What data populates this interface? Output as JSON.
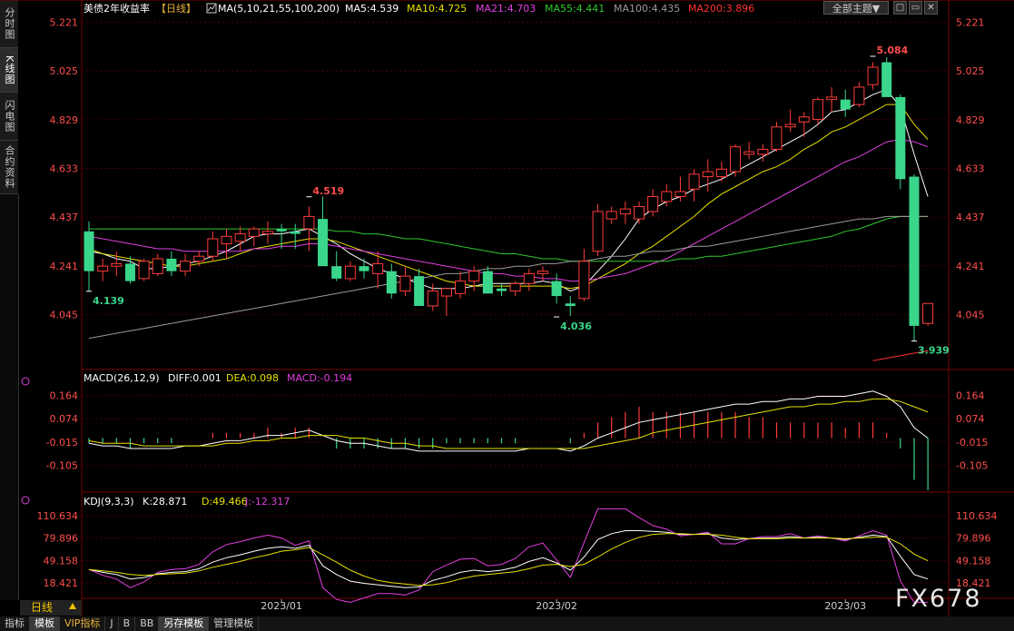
{
  "sidebar": {
    "tabs": [
      "分时图",
      "K线图",
      "闪电图",
      "合约资料"
    ]
  },
  "header": {
    "title": "美债2年收益率",
    "period_tag": "【日线】",
    "ma_label": "MA(5,10,21,55,100,200)",
    "ma5": "MA5:4.539",
    "ma10": "MA10:4.725",
    "ma21": "MA21:4.703",
    "ma55": "MA55:4.441",
    "ma100": "MA100:4.435",
    "ma200": "MA200:3.896",
    "dropdown_label": "全部主题▼",
    "btn_minimize": "□",
    "btn_restore": "▭",
    "btn_close": "✕"
  },
  "macd_header": {
    "label": "MACD(26,12,9)",
    "diff": "DIFF:0.001",
    "dea": "DEA:0.098",
    "macd": "MACD:-0.194"
  },
  "kdj_header": {
    "label": "KDJ(9,3,3)",
    "k": "K:28.871",
    "d": "D:49.466",
    "j": "J:-12.317"
  },
  "period_label": "日线",
  "bottom_tabs": [
    "指标",
    "模板",
    "VIP指标",
    "J",
    "B",
    "BB",
    "另存模板",
    "管理模板"
  ],
  "watermark": "FX678",
  "colors": {
    "up": "#ff3b3b",
    "down": "#3ad68c",
    "ma5": "#ffffff",
    "ma10": "#e6e000",
    "ma21": "#e040e0",
    "ma55": "#2ec82e",
    "ma100": "#9a9a9a",
    "ma200": "#ff3030",
    "axis_text": "#ff4d4d",
    "grid": "#4a0000"
  },
  "chart_data": [
    {
      "type": "candlestick",
      "title": "美债2年收益率",
      "y_ticks": [
        5.221,
        5.025,
        4.829,
        4.633,
        4.437,
        4.241,
        4.045
      ],
      "ylim": [
        3.85,
        5.23
      ],
      "x_ticks": [
        "2023/01",
        "2023/02",
        "2023/03"
      ],
      "annotations": [
        {
          "label": "4.139",
          "index": 0,
          "value": 4.139
        },
        {
          "label": "4.519",
          "index": 16,
          "value": 4.519
        },
        {
          "label": "4.036",
          "index": 34,
          "value": 4.036
        },
        {
          "label": "5.084",
          "index": 57,
          "value": 5.084
        },
        {
          "label": "3.939",
          "index": 60,
          "value": 3.939
        }
      ],
      "ohlc": [
        [
          4.38,
          4.42,
          4.14,
          4.22
        ],
        [
          4.22,
          4.27,
          4.18,
          4.24
        ],
        [
          4.24,
          4.3,
          4.2,
          4.25
        ],
        [
          4.25,
          4.28,
          4.17,
          4.18
        ],
        [
          4.19,
          4.27,
          4.18,
          4.26
        ],
        [
          4.21,
          4.29,
          4.2,
          4.27
        ],
        [
          4.27,
          4.3,
          4.2,
          4.22
        ],
        [
          4.22,
          4.29,
          4.2,
          4.26
        ],
        [
          4.26,
          4.3,
          4.24,
          4.28
        ],
        [
          4.28,
          4.38,
          4.26,
          4.35
        ],
        [
          4.33,
          4.39,
          4.27,
          4.36
        ],
        [
          4.34,
          4.4,
          4.3,
          4.37
        ],
        [
          4.36,
          4.4,
          4.32,
          4.39
        ],
        [
          4.37,
          4.42,
          4.33,
          4.38
        ],
        [
          4.39,
          4.41,
          4.31,
          4.38
        ],
        [
          4.38,
          4.41,
          4.31,
          4.37
        ],
        [
          4.39,
          4.48,
          4.3,
          4.44
        ],
        [
          4.43,
          4.52,
          4.38,
          4.24
        ],
        [
          4.24,
          4.3,
          4.18,
          4.19
        ],
        [
          4.19,
          4.26,
          4.18,
          4.24
        ],
        [
          4.24,
          4.27,
          4.19,
          4.22
        ],
        [
          4.21,
          4.3,
          4.15,
          4.25
        ],
        [
          4.22,
          4.25,
          4.11,
          4.13
        ],
        [
          4.14,
          4.24,
          4.12,
          4.2
        ],
        [
          4.2,
          4.23,
          4.08,
          4.08
        ],
        [
          4.08,
          4.17,
          4.06,
          4.14
        ],
        [
          4.12,
          4.14,
          4.04,
          4.15
        ],
        [
          4.13,
          4.22,
          4.11,
          4.18
        ],
        [
          4.18,
          4.24,
          4.14,
          4.22
        ],
        [
          4.22,
          4.24,
          4.14,
          4.13
        ],
        [
          4.15,
          4.17,
          4.12,
          4.14
        ],
        [
          4.14,
          4.18,
          4.12,
          4.17
        ],
        [
          4.17,
          4.23,
          4.14,
          4.21
        ],
        [
          4.21,
          4.24,
          4.18,
          4.22
        ],
        [
          4.18,
          4.21,
          4.09,
          4.12
        ],
        [
          4.09,
          4.12,
          4.04,
          4.08
        ],
        [
          4.11,
          4.31,
          4.1,
          4.26
        ],
        [
          4.3,
          4.49,
          4.28,
          4.46
        ],
        [
          4.43,
          4.48,
          4.41,
          4.46
        ],
        [
          4.45,
          4.5,
          4.41,
          4.47
        ],
        [
          4.43,
          4.5,
          4.41,
          4.48
        ],
        [
          4.46,
          4.55,
          4.44,
          4.52
        ],
        [
          4.5,
          4.57,
          4.48,
          4.54
        ],
        [
          4.52,
          4.6,
          4.5,
          4.54
        ],
        [
          4.55,
          4.63,
          4.5,
          4.61
        ],
        [
          4.6,
          4.67,
          4.54,
          4.62
        ],
        [
          4.6,
          4.66,
          4.58,
          4.63
        ],
        [
          4.62,
          4.73,
          4.6,
          4.72
        ],
        [
          4.69,
          4.74,
          4.67,
          4.7
        ],
        [
          4.69,
          4.73,
          4.66,
          4.71
        ],
        [
          4.71,
          4.82,
          4.7,
          4.8
        ],
        [
          4.8,
          4.87,
          4.78,
          4.81
        ],
        [
          4.82,
          4.86,
          4.76,
          4.84
        ],
        [
          4.83,
          4.92,
          4.81,
          4.91
        ],
        [
          4.91,
          4.96,
          4.86,
          4.92
        ],
        [
          4.91,
          4.95,
          4.84,
          4.87
        ],
        [
          4.89,
          4.98,
          4.88,
          4.96
        ],
        [
          4.97,
          5.06,
          4.95,
          5.04
        ],
        [
          5.06,
          5.08,
          4.96,
          4.92
        ],
        [
          4.92,
          4.93,
          4.55,
          4.59
        ],
        [
          4.6,
          4.61,
          3.94,
          4.0
        ],
        [
          4.01,
          4.09,
          4.0,
          4.09
        ]
      ],
      "ma": {
        "MA5": [
          4.3,
          4.29,
          4.27,
          4.26,
          4.23,
          4.23,
          4.24,
          4.25,
          4.26,
          4.28,
          4.3,
          4.33,
          4.36,
          4.37,
          4.37,
          4.38,
          4.39,
          4.36,
          4.33,
          4.29,
          4.26,
          4.23,
          4.21,
          4.19,
          4.17,
          4.15,
          4.15,
          4.15,
          4.16,
          4.17,
          4.17,
          4.17,
          4.17,
          4.18,
          4.17,
          4.14,
          4.16,
          4.22,
          4.28,
          4.35,
          4.43,
          4.47,
          4.5,
          4.52,
          4.55,
          4.57,
          4.59,
          4.62,
          4.65,
          4.68,
          4.71,
          4.74,
          4.77,
          4.81,
          4.86,
          4.87,
          4.9,
          4.93,
          4.95,
          4.88,
          4.69,
          4.52
        ],
        "MA10": [
          4.31,
          4.29,
          4.28,
          4.27,
          4.26,
          4.25,
          4.24,
          4.24,
          4.25,
          4.26,
          4.27,
          4.29,
          4.31,
          4.32,
          4.33,
          4.34,
          4.35,
          4.35,
          4.34,
          4.32,
          4.3,
          4.28,
          4.26,
          4.24,
          4.22,
          4.2,
          4.18,
          4.17,
          4.16,
          4.16,
          4.16,
          4.16,
          4.16,
          4.16,
          4.16,
          4.15,
          4.16,
          4.19,
          4.22,
          4.25,
          4.29,
          4.32,
          4.36,
          4.4,
          4.44,
          4.49,
          4.53,
          4.56,
          4.59,
          4.62,
          4.64,
          4.67,
          4.71,
          4.74,
          4.78,
          4.8,
          4.83,
          4.86,
          4.89,
          4.89,
          4.81,
          4.75
        ],
        "MA21": [
          4.36,
          4.35,
          4.34,
          4.33,
          4.32,
          4.31,
          4.31,
          4.3,
          4.3,
          4.3,
          4.3,
          4.3,
          4.31,
          4.31,
          4.32,
          4.32,
          4.33,
          4.33,
          4.32,
          4.31,
          4.3,
          4.29,
          4.28,
          4.27,
          4.26,
          4.25,
          4.24,
          4.23,
          4.22,
          4.21,
          4.21,
          4.2,
          4.2,
          4.19,
          4.19,
          4.18,
          4.18,
          4.19,
          4.2,
          4.21,
          4.23,
          4.25,
          4.27,
          4.3,
          4.33,
          4.36,
          4.39,
          4.42,
          4.45,
          4.48,
          4.51,
          4.54,
          4.57,
          4.6,
          4.63,
          4.66,
          4.68,
          4.71,
          4.74,
          4.75,
          4.74,
          4.72
        ],
        "MA55": [
          4.39,
          4.39,
          4.39,
          4.39,
          4.39,
          4.39,
          4.39,
          4.39,
          4.39,
          4.39,
          4.39,
          4.39,
          4.39,
          4.39,
          4.39,
          4.39,
          4.39,
          4.39,
          4.38,
          4.38,
          4.37,
          4.37,
          4.36,
          4.35,
          4.35,
          4.34,
          4.33,
          4.32,
          4.31,
          4.3,
          4.29,
          4.29,
          4.28,
          4.27,
          4.27,
          4.26,
          4.26,
          4.26,
          4.26,
          4.26,
          4.26,
          4.26,
          4.26,
          4.27,
          4.27,
          4.28,
          4.28,
          4.29,
          4.3,
          4.31,
          4.32,
          4.33,
          4.34,
          4.35,
          4.36,
          4.38,
          4.39,
          4.41,
          4.43,
          4.44,
          4.44,
          4.44
        ],
        "MA100": [
          3.95,
          3.96,
          3.97,
          3.98,
          3.99,
          4.0,
          4.01,
          4.02,
          4.03,
          4.04,
          4.05,
          4.06,
          4.07,
          4.08,
          4.09,
          4.1,
          4.11,
          4.12,
          4.13,
          4.14,
          4.15,
          4.16,
          4.17,
          4.18,
          4.19,
          4.2,
          4.21,
          4.21,
          4.22,
          4.23,
          4.23,
          4.24,
          4.24,
          4.25,
          4.25,
          4.26,
          4.26,
          4.27,
          4.28,
          4.28,
          4.29,
          4.3,
          4.3,
          4.31,
          4.32,
          4.32,
          4.33,
          4.34,
          4.35,
          4.36,
          4.37,
          4.38,
          4.39,
          4.4,
          4.41,
          4.42,
          4.43,
          4.43,
          4.44,
          4.44,
          4.44,
          4.44
        ]
      },
      "ma200_tail": [
        3.86,
        3.87,
        3.88,
        3.89,
        3.9
      ]
    },
    {
      "type": "macd",
      "title": "MACD(26,12,9)",
      "y_ticks": [
        0.164,
        0.074,
        -0.015,
        -0.105
      ],
      "ylim": [
        -0.2,
        0.2
      ],
      "diff": [
        -0.02,
        -0.03,
        -0.03,
        -0.04,
        -0.04,
        -0.04,
        -0.04,
        -0.03,
        -0.03,
        -0.02,
        -0.01,
        -0.01,
        0.0,
        0.01,
        0.01,
        0.02,
        0.03,
        0.01,
        -0.01,
        -0.02,
        -0.02,
        -0.03,
        -0.04,
        -0.04,
        -0.05,
        -0.05,
        -0.05,
        -0.05,
        -0.05,
        -0.05,
        -0.05,
        -0.05,
        -0.04,
        -0.04,
        -0.04,
        -0.05,
        -0.03,
        0.0,
        0.02,
        0.04,
        0.06,
        0.07,
        0.08,
        0.09,
        0.1,
        0.11,
        0.12,
        0.13,
        0.13,
        0.14,
        0.14,
        0.15,
        0.15,
        0.16,
        0.16,
        0.16,
        0.17,
        0.18,
        0.16,
        0.12,
        0.04,
        0.0
      ],
      "dea": [
        -0.01,
        -0.02,
        -0.02,
        -0.02,
        -0.03,
        -0.03,
        -0.03,
        -0.03,
        -0.03,
        -0.03,
        -0.02,
        -0.02,
        -0.01,
        -0.01,
        0.0,
        0.0,
        0.01,
        0.01,
        0.01,
        0.0,
        0.0,
        -0.01,
        -0.02,
        -0.02,
        -0.03,
        -0.03,
        -0.04,
        -0.04,
        -0.04,
        -0.04,
        -0.04,
        -0.04,
        -0.04,
        -0.04,
        -0.04,
        -0.04,
        -0.04,
        -0.03,
        -0.02,
        -0.01,
        0.0,
        0.02,
        0.03,
        0.04,
        0.05,
        0.06,
        0.07,
        0.08,
        0.09,
        0.1,
        0.11,
        0.12,
        0.12,
        0.13,
        0.13,
        0.14,
        0.14,
        0.15,
        0.15,
        0.14,
        0.12,
        0.1
      ]
    },
    {
      "type": "kdj",
      "title": "KDJ(9,3,3)",
      "y_ticks": [
        110.634,
        79.896,
        49.158,
        18.421
      ],
      "ylim": [
        0,
        118
      ],
      "k": [
        37,
        33,
        30,
        24,
        26,
        31,
        33,
        34,
        38,
        47,
        53,
        57,
        62,
        66,
        68,
        66,
        70,
        42,
        30,
        21,
        18,
        16,
        14,
        12,
        13,
        22,
        27,
        33,
        36,
        34,
        36,
        40,
        48,
        53,
        46,
        36,
        54,
        78,
        86,
        90,
        90,
        89,
        88,
        85,
        85,
        86,
        80,
        78,
        79,
        80,
        80,
        82,
        80,
        81,
        80,
        78,
        81,
        84,
        82,
        55,
        30,
        24
      ],
      "d": [
        37,
        35,
        33,
        30,
        29,
        30,
        31,
        32,
        35,
        40,
        44,
        48,
        53,
        57,
        62,
        64,
        67,
        57,
        47,
        36,
        28,
        22,
        19,
        17,
        15,
        16,
        19,
        24,
        28,
        30,
        32,
        34,
        38,
        43,
        44,
        41,
        44,
        54,
        65,
        74,
        81,
        85,
        86,
        86,
        85,
        85,
        84,
        81,
        79,
        79,
        79,
        80,
        80,
        80,
        80,
        79,
        80,
        81,
        81,
        72,
        58,
        49
      ],
      "j": [
        37,
        29,
        24,
        12,
        20,
        33,
        37,
        38,
        44,
        61,
        71,
        75,
        80,
        84,
        80,
        70,
        76,
        12,
        -4,
        -9,
        -2,
        4,
        4,
        2,
        9,
        34,
        43,
        51,
        52,
        42,
        44,
        52,
        68,
        73,
        50,
        26,
        74,
        126,
        128,
        122,
        108,
        97,
        92,
        83,
        85,
        88,
        72,
        72,
        79,
        82,
        82,
        86,
        80,
        83,
        80,
        76,
        83,
        90,
        84,
        21,
        -26,
        -12
      ]
    }
  ]
}
